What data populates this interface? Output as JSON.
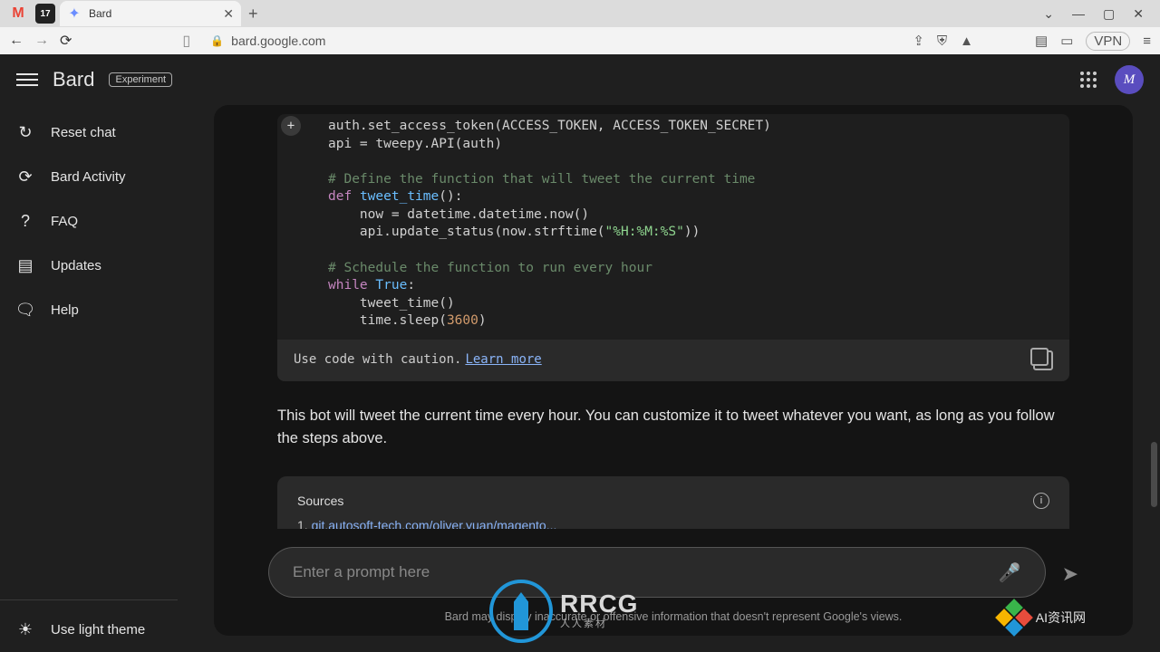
{
  "browser": {
    "tab_title": "Bard",
    "url": "bard.google.com",
    "window_controls": {
      "dropdown": "⌄",
      "min": "—",
      "max": "▢",
      "close": "✕"
    },
    "new_tab": "+",
    "close_tab": "✕",
    "vpn": "VPN"
  },
  "header": {
    "brand": "Bard",
    "badge": "Experiment",
    "avatar_initial": "M"
  },
  "sidebar": {
    "items": [
      {
        "icon": "↻",
        "label": "Reset chat"
      },
      {
        "icon": "⟳",
        "label": "Bard Activity"
      },
      {
        "icon": "?",
        "label": "FAQ"
      },
      {
        "icon": "▤",
        "label": "Updates"
      },
      {
        "icon": "🗨",
        "label": "Help"
      }
    ],
    "theme": {
      "icon": "☀",
      "label": "Use light theme"
    }
  },
  "code": {
    "plus": "+",
    "line1a": "auth.set_access_token(ACCESS_TOKEN, ACCESS_TOKEN_SECRET)",
    "line2a": "api = tweepy.API(auth)",
    "comment1": "# Define the function that will tweet the current time",
    "def": "def",
    "fn_name": "tweet_time",
    "paren": "():",
    "now_line": "    now = datetime.datetime.now()",
    "upd_prefix": "    api.update_status(now.strftime(",
    "fmt_str": "\"%H:%M:%S\"",
    "upd_suffix": "))",
    "comment2": "# Schedule the function to run every hour",
    "while_kw": "while",
    "true_kw": "True",
    "colon": ":",
    "call_line": "    tweet_time()",
    "sleep_prefix": "    time.sleep(",
    "sleep_num": "3600",
    "sleep_suffix": ")",
    "caution": "Use code with caution.",
    "learn_more": "Learn more"
  },
  "response": "This bot will tweet the current time every hour. You can customize it to tweet whatever you want, as long as you follow the steps above.",
  "sources": {
    "title": "Sources",
    "num": "1.",
    "link": "git.autosoft-tech.com/oliver.yuan/magento...",
    "info": "i"
  },
  "input": {
    "placeholder": "Enter a prompt here"
  },
  "disclaimer": "Bard may display inaccurate or offensive information that doesn't represent Google's views.",
  "watermarks": {
    "rrcg": "RRCG",
    "rrcg_sub": "人人素材",
    "ai": "AI资讯网"
  }
}
